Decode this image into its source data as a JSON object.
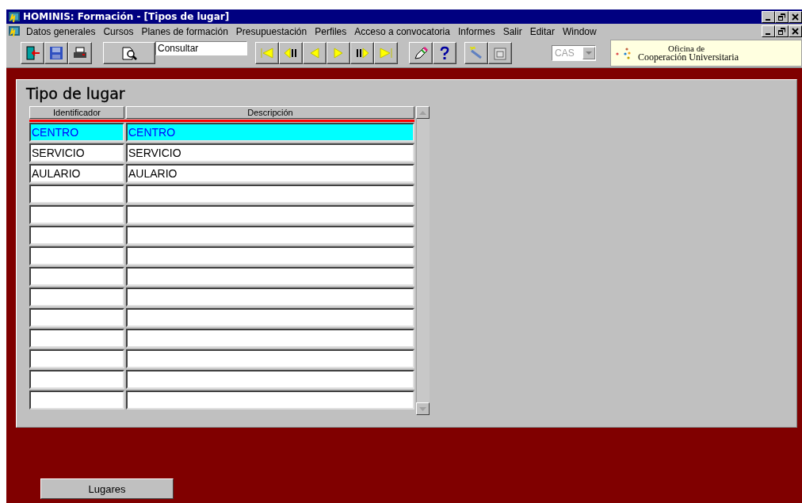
{
  "window": {
    "title": "HOMINIS: Formación - [Tipos de lugar]"
  },
  "menu": [
    "Datos generales",
    "Cursos",
    "Planes de formación",
    "Presupuestación",
    "Perfiles",
    "Acceso a convocatoria",
    "Informes",
    "Salir",
    "Editar",
    "Window"
  ],
  "toolbar": {
    "mode_field": {
      "value": "Consultar"
    },
    "language": {
      "value": "CAS",
      "disabled": true
    },
    "logo": {
      "line_1": "Oficina de",
      "line_2": "Cooperación Universitaria"
    }
  },
  "form": {
    "title": "Tipo de lugar",
    "columns": [
      "Identificador",
      "Descripción"
    ],
    "rows": [
      {
        "id": "CENTRO",
        "description": "CENTRO",
        "selected": true
      },
      {
        "id": "SERVICIO",
        "description": "SERVICIO",
        "selected": false
      },
      {
        "id": "AULARIO",
        "description": "AULARIO",
        "selected": false
      },
      {
        "selected": false
      },
      {
        "selected": false
      },
      {
        "selected": false
      },
      {
        "selected": false
      },
      {
        "selected": false
      },
      {
        "selected": false
      },
      {
        "selected": false
      },
      {
        "selected": false
      },
      {
        "selected": false
      },
      {
        "selected": false
      },
      {
        "selected": false
      }
    ]
  },
  "buttons": [
    "Lugares"
  ]
}
